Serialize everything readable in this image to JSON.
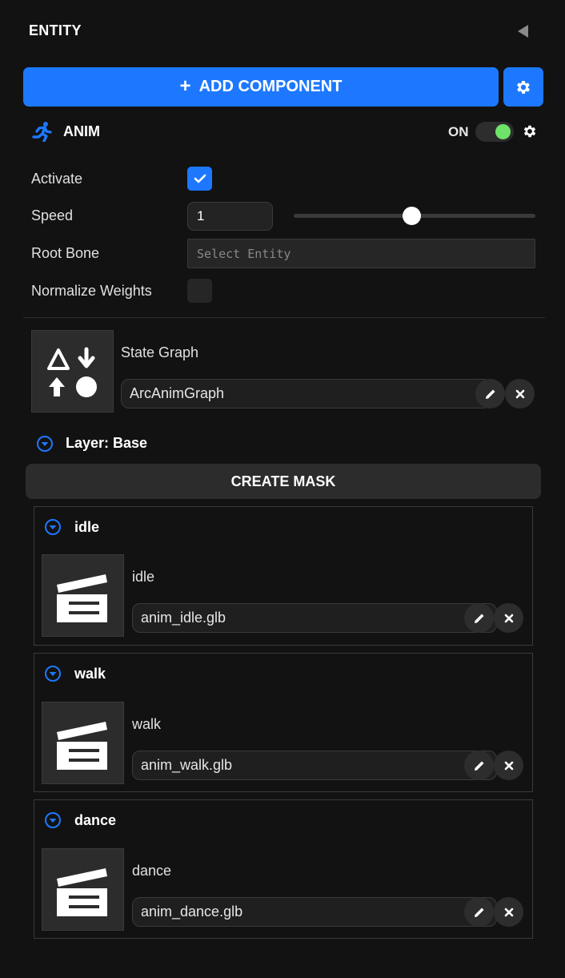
{
  "panel": {
    "title": "ENTITY"
  },
  "add_component": {
    "label": "ADD COMPONENT"
  },
  "component": {
    "title": "ANIM",
    "enabled_label": "ON",
    "enabled": true
  },
  "fields": {
    "activate": {
      "label": "Activate",
      "checked": true
    },
    "speed": {
      "label": "Speed",
      "value": "1",
      "slider_fraction": 0.49
    },
    "root_bone": {
      "label": "Root Bone",
      "placeholder": "Select Entity"
    },
    "normalize_weights": {
      "label": "Normalize Weights",
      "checked": false
    }
  },
  "state_graph": {
    "label": "State Graph",
    "value": "ArcAnimGraph"
  },
  "layer": {
    "title": "Layer: Base",
    "create_mask_label": "CREATE MASK"
  },
  "clips": [
    {
      "title": "idle",
      "label": "idle",
      "file": "anim_idle.glb"
    },
    {
      "title": "walk",
      "label": "walk",
      "file": "anim_walk.glb"
    },
    {
      "title": "dance",
      "label": "dance",
      "file": "anim_dance.glb"
    }
  ],
  "colors": {
    "accent": "#1d78ff",
    "toggle_on": "#6ee36a",
    "background": "#121212"
  },
  "icons": {
    "collapse": "triangle-left-icon",
    "add": "plus-icon",
    "settings": "gear-icon",
    "component": "running-figure-icon",
    "state_graph_thumbnail": "shapes-icon",
    "edit": "pencil-icon",
    "clear": "close-icon",
    "expand": "chevron-down-circle-icon",
    "clip_thumbnail": "clapperboard-icon"
  }
}
